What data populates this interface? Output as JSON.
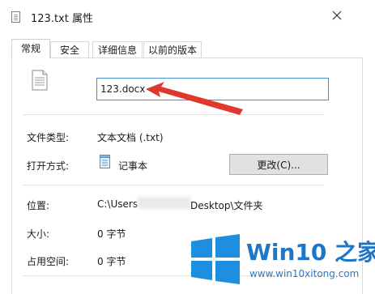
{
  "window": {
    "title": "123.txt 属性",
    "close_icon": "close-icon"
  },
  "tabs": [
    {
      "label": "常规",
      "active": true
    },
    {
      "label": "安全",
      "active": false
    },
    {
      "label": "详细信息",
      "active": false
    },
    {
      "label": "以前的版本",
      "active": false
    }
  ],
  "general": {
    "file_name_value": "123.docx",
    "rows": {
      "file_type": {
        "label": "文件类型:",
        "value": "文本文档 (.txt)"
      },
      "open_with": {
        "label": "打开方式:",
        "value": "记事本",
        "button_label": "更改(C)..."
      },
      "location": {
        "label": "位置:",
        "value_prefix": "C:\\Users",
        "value_suffix": "Desktop\\文件夹"
      },
      "size": {
        "label": "大小:",
        "value": "0 字节"
      },
      "size_on_disk": {
        "label": "占用空间:",
        "value": "0 字节"
      }
    }
  },
  "watermark": {
    "brand": "Win10 之家",
    "url": "www.win10xitong.com",
    "colors": {
      "logo": "#1e8fe0",
      "text": "#1e76c8"
    }
  },
  "annotation": {
    "arrow_color": "#e0382e"
  }
}
